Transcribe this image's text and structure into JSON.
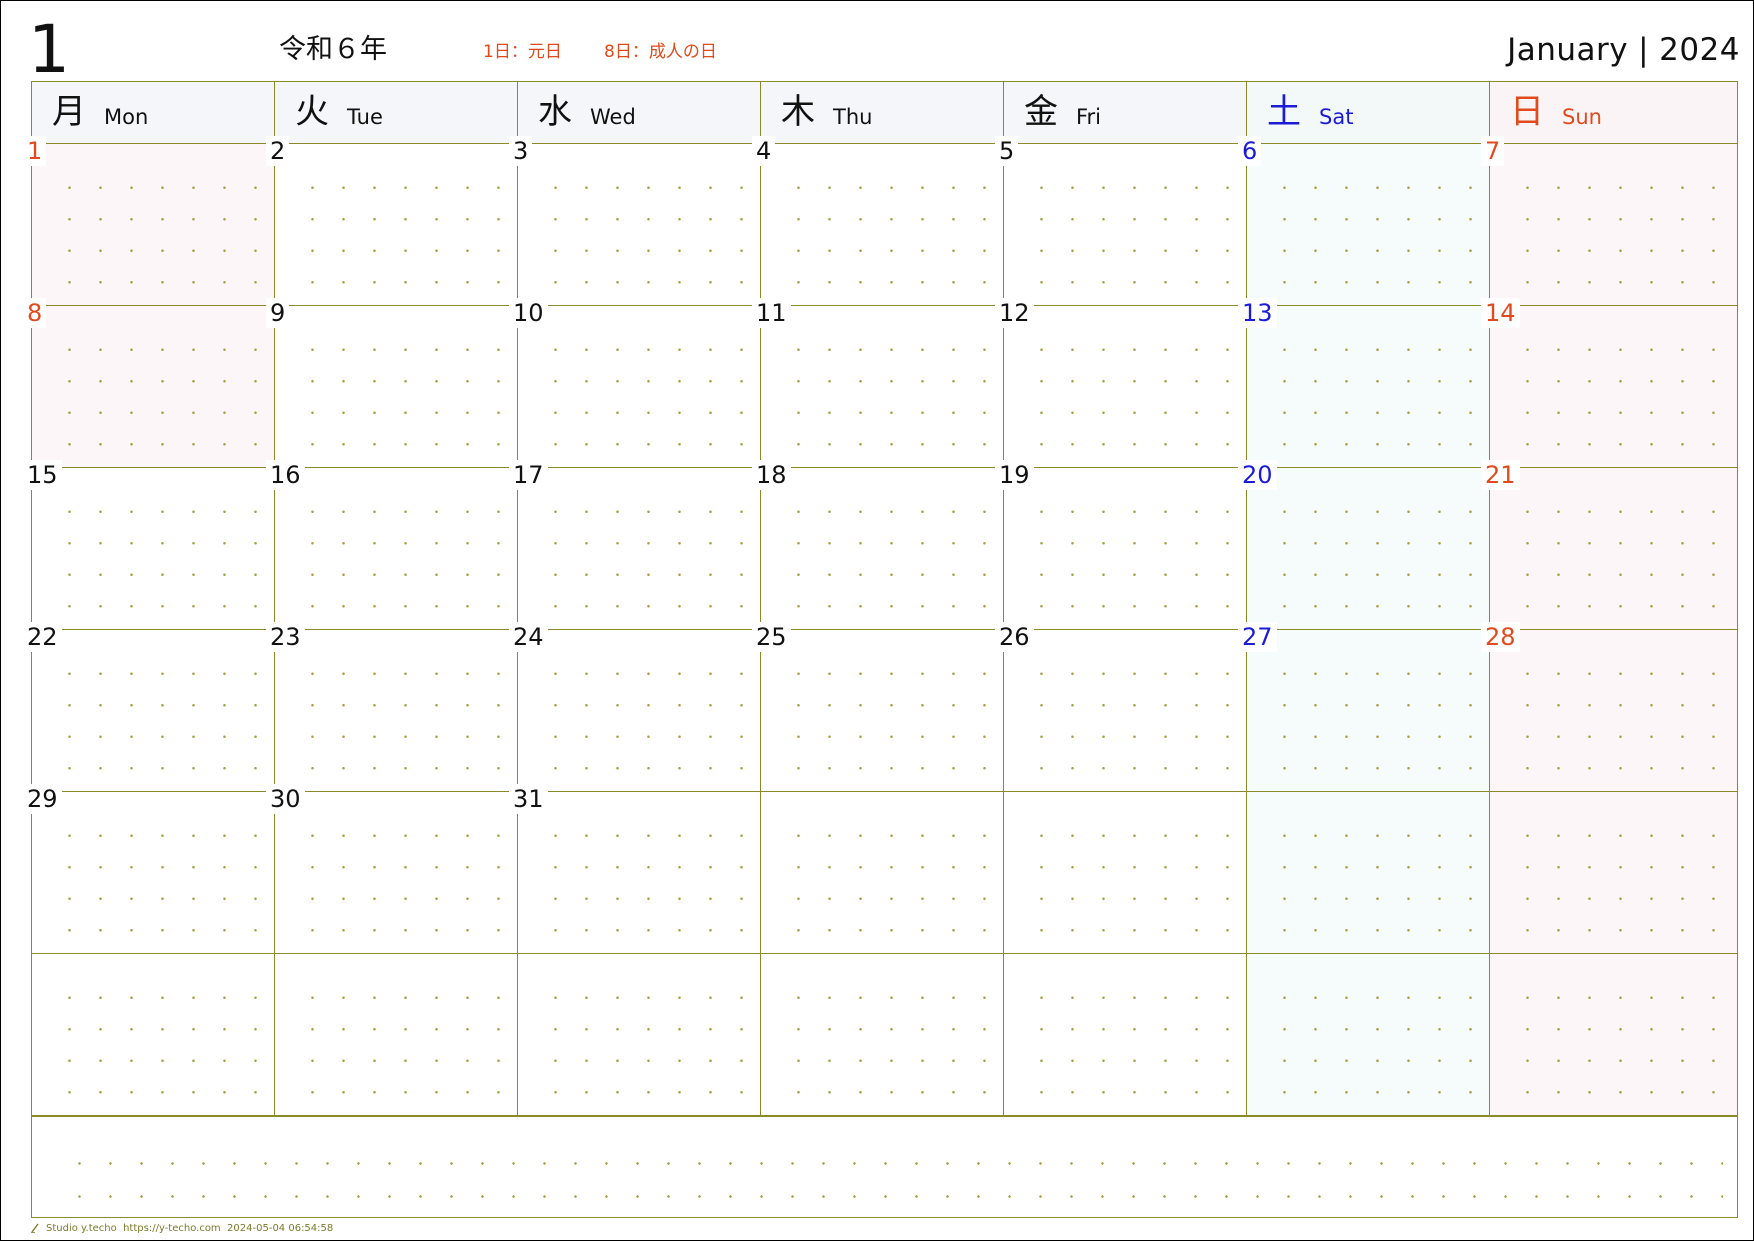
{
  "header": {
    "month_number": "1",
    "era_year": "令和６年",
    "holiday_notes": [
      "1日：元日",
      "8日：成人の日"
    ],
    "month_name": "January",
    "separator": "|",
    "year": "2024"
  },
  "weekdays": [
    {
      "kanji": "月",
      "en": "Mon"
    },
    {
      "kanji": "火",
      "en": "Tue"
    },
    {
      "kanji": "水",
      "en": "Wed"
    },
    {
      "kanji": "木",
      "en": "Thu"
    },
    {
      "kanji": "金",
      "en": "Fri"
    },
    {
      "kanji": "土",
      "en": "Sat"
    },
    {
      "kanji": "日",
      "en": "Sun"
    }
  ],
  "weeks": [
    [
      "1",
      "2",
      "3",
      "4",
      "5",
      "6",
      "7"
    ],
    [
      "8",
      "9",
      "10",
      "11",
      "12",
      "13",
      "14"
    ],
    [
      "15",
      "16",
      "17",
      "18",
      "19",
      "20",
      "21"
    ],
    [
      "22",
      "23",
      "24",
      "25",
      "26",
      "27",
      "28"
    ],
    [
      "29",
      "30",
      "31",
      "",
      "",
      "",
      ""
    ],
    [
      "",
      "",
      "",
      "",
      "",
      "",
      ""
    ]
  ],
  "holidays": [
    "1",
    "8"
  ],
  "colors": {
    "grid_line": "#8a8a2a",
    "saturday": "#1b1bd6",
    "sunday_holiday": "#e04a1c"
  },
  "footer": {
    "brand": "Studio y.techo",
    "url": "https://y-techo.com",
    "timestamp": "2024-05-04 06:54:58"
  }
}
